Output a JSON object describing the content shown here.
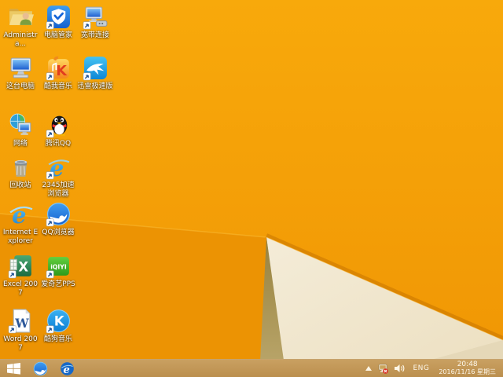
{
  "desktop": {
    "icons": [
      {
        "id": "administrator-folder",
        "label": "Administra...",
        "art": "folder",
        "col": 0,
        "row": 0
      },
      {
        "id": "pc-manager",
        "label": "电脑管家",
        "art": "guanjia",
        "col": 1,
        "row": 0
      },
      {
        "id": "broadband-connection",
        "label": "宽带连接",
        "art": "broadband",
        "col": 2,
        "row": 0
      },
      {
        "id": "this-pc",
        "label": "这台电脑",
        "art": "thispc",
        "col": 0,
        "row": 1
      },
      {
        "id": "kuwo-music",
        "label": "酷我音乐",
        "art": "kuwo",
        "col": 1,
        "row": 1
      },
      {
        "id": "xunlei-speed",
        "label": "迅雷极速版",
        "art": "xunlei",
        "col": 2,
        "row": 1
      },
      {
        "id": "network",
        "label": "网络",
        "art": "network",
        "col": 0,
        "row": 2
      },
      {
        "id": "tencent-qq",
        "label": "腾讯QQ",
        "art": "qq",
        "col": 1,
        "row": 2
      },
      {
        "id": "recycle-bin",
        "label": "回收站",
        "art": "recycle",
        "col": 0,
        "row": 3
      },
      {
        "id": "browser-2345",
        "label": "2345加速浏览器",
        "art": "e2345",
        "col": 1,
        "row": 3
      },
      {
        "id": "internet-explorer",
        "label": "Internet Explorer",
        "art": "ie",
        "col": 0,
        "row": 4
      },
      {
        "id": "qq-browser",
        "label": "QQ浏览器",
        "art": "qqbrowser",
        "col": 1,
        "row": 4
      },
      {
        "id": "excel-2007",
        "label": "Excel 2007",
        "art": "excel",
        "col": 0,
        "row": 5
      },
      {
        "id": "iqiyi-pps",
        "label": "爱奇艺PPS",
        "art": "iqiyi",
        "col": 1,
        "row": 5
      },
      {
        "id": "word-2007",
        "label": "Word 2007",
        "art": "word",
        "col": 0,
        "row": 6
      },
      {
        "id": "kugou-music",
        "label": "酷狗音乐",
        "art": "kugou",
        "col": 1,
        "row": 6
      }
    ]
  },
  "taskbar": {
    "pinned": [
      {
        "id": "qq-browser",
        "art": "tbqq"
      },
      {
        "id": "internet-explorer",
        "art": "tbie"
      }
    ],
    "tray": {
      "language": "ENG",
      "time": "20:48",
      "date": "2016/11/16 星期三"
    }
  },
  "colors": {
    "wallpaper_orange": "#f6a307",
    "wallpaper_wedge": "#ec9303",
    "wallpaper_cream": "#f1e7ce",
    "wallpaper_tan": "#a68f4f",
    "taskbar": "#bf9452"
  }
}
